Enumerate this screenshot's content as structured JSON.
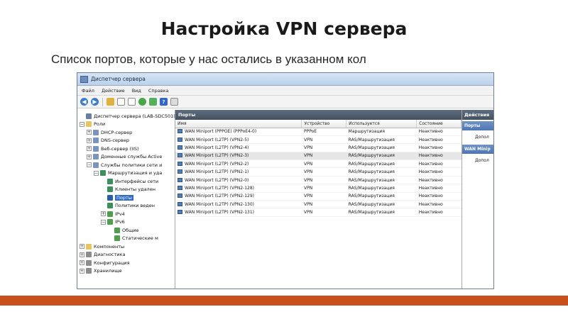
{
  "slide": {
    "title": "Настройка VPN сервера",
    "subtitle": "Список портов, которые у нас остались в указанном кол"
  },
  "window": {
    "title": "Диспетчер сервера",
    "menu": [
      "Файл",
      "Действие",
      "Вид",
      "Справка"
    ]
  },
  "tree": [
    {
      "label": "Диспетчер сервера (LAB-SDC501)",
      "icon": "server",
      "level": 0,
      "exp": "none"
    },
    {
      "label": "Роли",
      "icon": "folder",
      "level": 0,
      "exp": "minus"
    },
    {
      "label": "DHCP-сервер",
      "icon": "role",
      "level": 1,
      "exp": "plus"
    },
    {
      "label": "DNS-сервер",
      "icon": "role",
      "level": 1,
      "exp": "plus"
    },
    {
      "label": "Веб-сервер (IIS)",
      "icon": "role",
      "level": 1,
      "exp": "plus"
    },
    {
      "label": "Доменные службы Active",
      "icon": "role",
      "level": 1,
      "exp": "plus"
    },
    {
      "label": "Службы политики сети и",
      "icon": "role",
      "level": 1,
      "exp": "minus"
    },
    {
      "label": "Маршрутизация и уда",
      "icon": "net",
      "level": 2,
      "exp": "minus"
    },
    {
      "label": "Интерфейсы сети",
      "icon": "net",
      "level": 3,
      "exp": "none"
    },
    {
      "label": "Клиенты удален",
      "icon": "net",
      "level": 3,
      "exp": "none"
    },
    {
      "label": "Порты",
      "icon": "ports",
      "level": 3,
      "exp": "none",
      "selected": true
    },
    {
      "label": "Политики веден",
      "icon": "net",
      "level": 3,
      "exp": "none"
    },
    {
      "label": "IPv4",
      "icon": "ip",
      "level": 3,
      "exp": "plus"
    },
    {
      "label": "IPv6",
      "icon": "ip",
      "level": 3,
      "exp": "minus"
    },
    {
      "label": "Общие",
      "icon": "ip",
      "level": 4,
      "exp": "none"
    },
    {
      "label": "Статические м",
      "icon": "ip",
      "level": 4,
      "exp": "none"
    },
    {
      "label": "Компоненты",
      "icon": "folder",
      "level": 0,
      "exp": "plus"
    },
    {
      "label": "Диагностика",
      "icon": "tool",
      "level": 0,
      "exp": "plus"
    },
    {
      "label": "Конфигурация",
      "icon": "tool",
      "level": 0,
      "exp": "plus"
    },
    {
      "label": "Хранилище",
      "icon": "tool",
      "level": 0,
      "exp": "plus"
    }
  ],
  "ports": {
    "header": "Порты",
    "columns": [
      "Имя",
      "Устройство",
      "Используется",
      "Состояние"
    ],
    "rows": [
      {
        "name": "WAN Miniport (PPPOE) (PPPoE4-0)",
        "device": "PPPoE",
        "used": "Маршрутизация",
        "state": "Неактивно"
      },
      {
        "name": "WAN Miniport (L2TP) (VPN2-5)",
        "device": "VPN",
        "used": "RAS/Маршрутизация",
        "state": "Неактивно"
      },
      {
        "name": "WAN Miniport (L2TP) (VPN2-4)",
        "device": "VPN",
        "used": "RAS/Маршрутизация",
        "state": "Неактивно"
      },
      {
        "name": "WAN Miniport (L2TP) (VPN2-3)",
        "device": "VPN",
        "used": "RAS/Маршрутизация",
        "state": "Неактивно",
        "selected": true
      },
      {
        "name": "WAN Miniport (L2TP) (VPN2-2)",
        "device": "VPN",
        "used": "RAS/Маршрутизация",
        "state": "Неактивно"
      },
      {
        "name": "WAN Miniport (L2TP) (VPN2-1)",
        "device": "VPN",
        "used": "RAS/Маршрутизация",
        "state": "Неактивно"
      },
      {
        "name": "WAN Miniport (L2TP) (VPN2-0)",
        "device": "VPN",
        "used": "RAS/Маршрутизация",
        "state": "Неактивно"
      },
      {
        "name": "WAN Miniport (L2TP) (VPN2-128)",
        "device": "VPN",
        "used": "RAS/Маршрутизация",
        "state": "Неактивно"
      },
      {
        "name": "WAN Miniport (L2TP) (VPN2-129)",
        "device": "VPN",
        "used": "RAS/Маршрутизация",
        "state": "Неактивно"
      },
      {
        "name": "WAN Miniport (L2TP) (VPN2-130)",
        "device": "VPN",
        "used": "RAS/Маршрутизация",
        "state": "Неактивно"
      },
      {
        "name": "WAN Miniport (L2TP) (VPN2-131)",
        "device": "VPN",
        "used": "RAS/Маршрутизация",
        "state": "Неактивно"
      }
    ]
  },
  "actions": {
    "header": "Действия",
    "group1": "Порты",
    "item1": "Допол",
    "group2": "WAN Minip",
    "item2": "Допол"
  },
  "colors": {
    "accent_bar": "#c8511e",
    "pane_header": "#4a5667",
    "selection": "#3069c6"
  }
}
